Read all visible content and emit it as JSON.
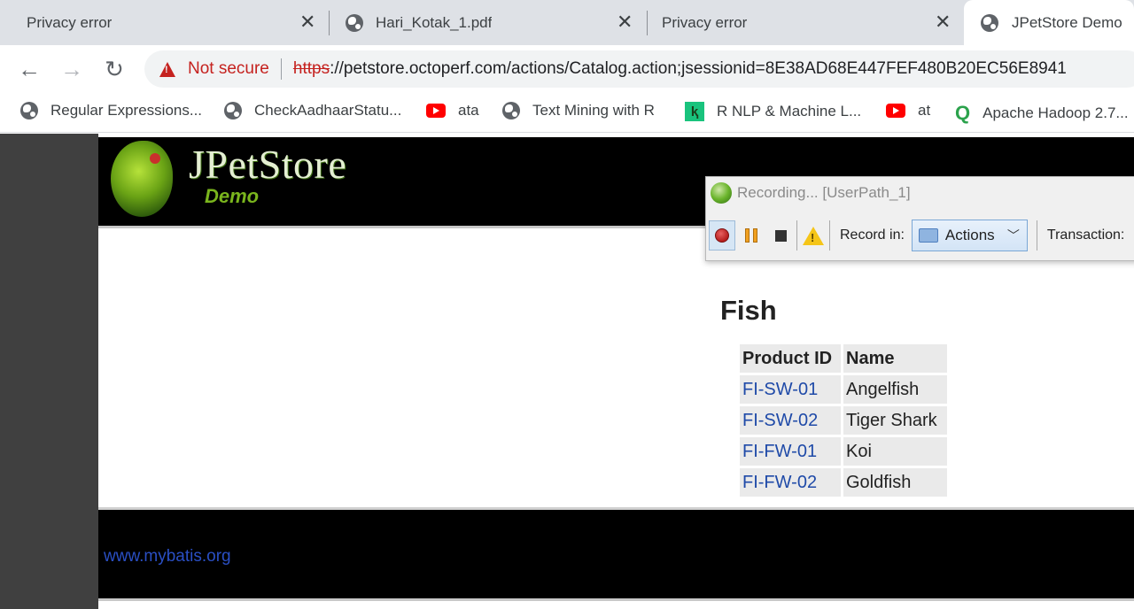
{
  "browser": {
    "tabs": [
      {
        "title": "Privacy error",
        "has_icon": false
      },
      {
        "title": "Hari_Kotak_1.pdf",
        "has_icon": true
      },
      {
        "title": "Privacy error",
        "has_icon": false
      },
      {
        "title": "JPetStore Demo",
        "has_icon": true,
        "active": true
      }
    ],
    "close_glyph": "✕",
    "nav": {
      "back": "←",
      "forward": "→",
      "reload": "↻"
    },
    "address": {
      "security_label": "Not secure",
      "scheme": "https",
      "rest": "://petstore.octoperf.com/actions/Catalog.action;jsessionid=8E38AD68E447FEF480B20EC56E8941"
    },
    "bookmarks": [
      {
        "label": "Regular Expressions...",
        "icon": "globe-icon"
      },
      {
        "label": "CheckAadhaarStatu...",
        "icon": "globe-icon"
      },
      {
        "label": "ata",
        "icon": "youtube-icon"
      },
      {
        "label": "Text Mining with R",
        "icon": "globe-icon"
      },
      {
        "label": "R NLP & Machine L...",
        "icon": "rnlp-icon"
      },
      {
        "label": "at",
        "icon": "youtube-icon"
      },
      {
        "label": "Apache Hadoop 2.7...",
        "icon": "qubole-icon"
      }
    ]
  },
  "site": {
    "logo_title": "JPetStore",
    "logo_subtitle": "Demo",
    "category_title": "Fish",
    "table": {
      "headers": [
        "Product ID",
        "Name"
      ],
      "rows": [
        {
          "id": "FI-SW-01",
          "name": "Angelfish"
        },
        {
          "id": "FI-SW-02",
          "name": "Tiger Shark"
        },
        {
          "id": "FI-FW-01",
          "name": "Koi"
        },
        {
          "id": "FI-FW-02",
          "name": "Goldfish"
        }
      ]
    },
    "footer_link": "www.mybatis.org"
  },
  "recorder": {
    "title": "Recording... [UserPath_1]",
    "record_in_label": "Record in:",
    "record_in_value": "Actions",
    "transaction_label": "Transaction:"
  }
}
